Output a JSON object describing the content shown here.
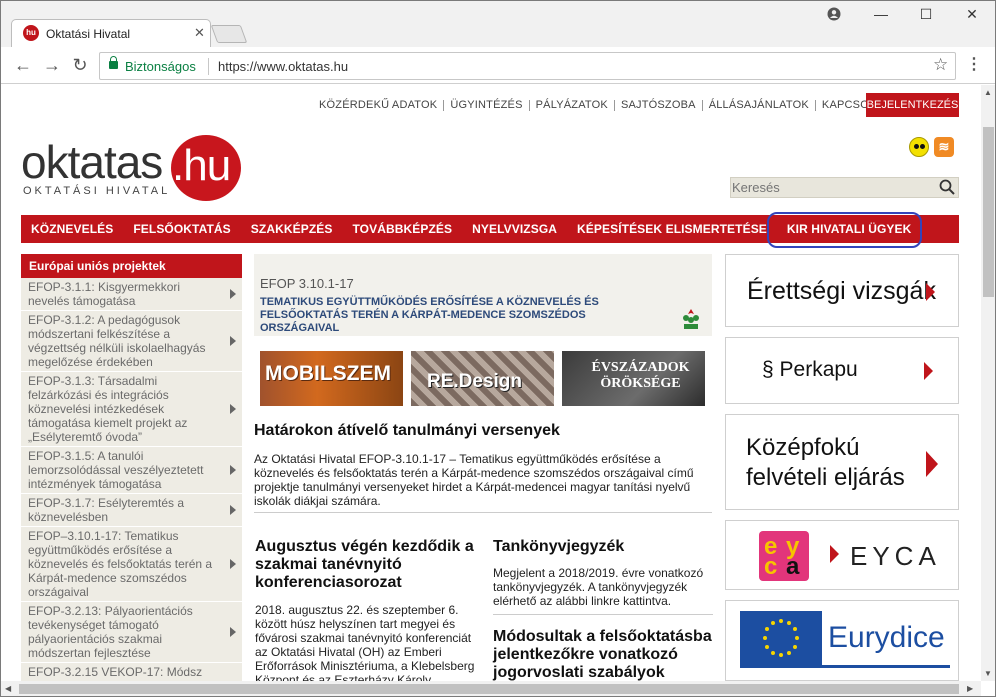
{
  "browser": {
    "tab_title": "Oktatási Hivatal",
    "favicon_text": "hu",
    "security_label": "Biztonságos",
    "url": "https://www.oktatas.hu"
  },
  "header": {
    "top_links": [
      "KÖZÉRDEKŰ ADATOK",
      "ÜGYINTÉZÉS",
      "PÁLYÁZATOK",
      "SAJTÓSZOBA",
      "ÁLLÁSAJÁNLATOK",
      "KAPCSOLAT"
    ],
    "login_label": "BEJELENTKEZÉS",
    "logo_word": "oktatas",
    "logo_suffix": ".hu",
    "logo_subtitle": "OKTATÁSI HIVATAL",
    "search_placeholder": "Keresés"
  },
  "main_nav": [
    "KÖZNEVELÉS",
    "FELSŐOKTATÁS",
    "SZAKKÉPZÉS",
    "TOVÁBBKÉPZÉS",
    "NYELVVIZSGA",
    "KÉPESÍTÉSEK ELISMERTETÉSE",
    "KIR HIVATALI ÜGYEK"
  ],
  "sidebar": {
    "heading": "Európai uniós projektek",
    "items": [
      "EFOP-3.1.1: Kisgyermekkori nevelés támogatása",
      "EFOP-3.1.2: A pedagógusok módszertani felkészítése a végzettség nélküli iskolaelhagyás megelőzése érdekében",
      "EFOP-3.1.3: Társadalmi felzárkózási és integrációs köznevelési intézkedések támogatása kiemelt projekt az „Esélyteremtő óvoda”",
      "EFOP-3.1.5: A tanulói lemorzsolódással veszélyeztetett intézmények támogatása",
      "EFOP-3.1.7: Esélyteremtés a köznevelésben",
      "EFOP–3.10.1-17: Tematikus együttműködés erősítése a köznevelés és felsőoktatás terén a Kárpát-medence szomszédos országaival",
      "EFOP-3.2.13: Pályaorientációs tevékenységet támogató pályaorientációs szakmai módszertan fejlesztése",
      "EFOP-3.2.15 VEKOP-17: Módsz"
    ]
  },
  "efop_box": {
    "code": "EFOP 3.10.1-17",
    "description": "TEMATIKUS EGYÜTTMŰKÖDÉS ERŐSÍTÉSE A KÖZNEVELÉS ÉS FELSŐOKTATÁS TERÉN A KÁRPÁT-MEDENCE SZOMSZÉDOS ORSZÁGAIVAL"
  },
  "banners": [
    "MOBILSZEM",
    "RE.Design",
    "ÉVSZÁZADOK ÖRÖKSÉGE"
  ],
  "articles": {
    "a1": {
      "title": "Határokon átívelő tanulmányi versenyek",
      "body": "Az Oktatási Hivatal EFOP-3.10.1-17 – Tematikus együttműködés erősítése a köznevelés és felsőoktatás terén a Kárpát-medence szomszédos országaival című projektje tanulmányi versenyeket hirdet a Kárpát-medencei magyar tanítási nyelvű iskolák diákjai számára."
    },
    "a2": {
      "title": "Augusztus végén kezdődik a szakmai tanévnyitó konferenciasorozat",
      "body": "2018. augusztus 22. és szeptember 6. között húsz helyszínen tart megyei és fővárosi szakmai tanévnyitó konferenciát az Oktatási Hivatal (OH) az Emberi Erőforrások Minisztériuma, a Klebelsberg Központ és az Eszterházy Károly"
    },
    "a3": {
      "title": "Tankönyvjegyzék",
      "body": "Megjelent a 2018/2019. évre vonatkozó tankönyvjegyzék. A tankönyvjegyzék elérhető az alábbi linkre kattintva."
    },
    "a4": {
      "title": "Módosultak a felsőoktatásba jelentkezőkre vonatkozó jogorvoslati szabályok"
    }
  },
  "right_boxes": {
    "r1": "Érettségi vizsgák",
    "r2": "§ Perkapu",
    "r3": "Középfokú felvételi eljárás",
    "r4": "EYCA",
    "r5": "Eurydice"
  },
  "colors": {
    "brand_red": "#c0151b",
    "sidebar_bg": "#eeece4",
    "efop_blue": "#2d4a7a"
  }
}
